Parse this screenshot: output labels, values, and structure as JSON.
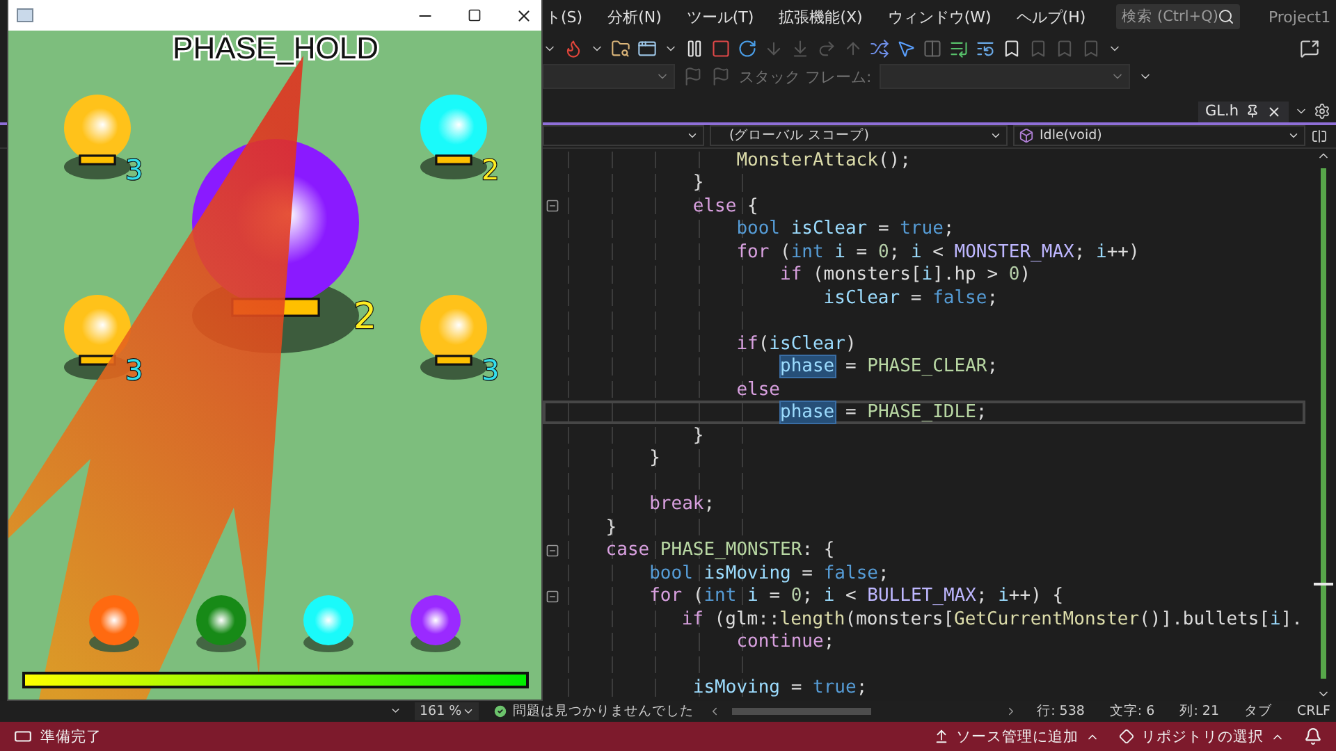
{
  "ide": {
    "menu": [
      "ト(S)",
      "分析(N)",
      "ツール(T)",
      "拡張機能(X)",
      "ウィンドウ(W)",
      "ヘルプ(H)"
    ],
    "search": {
      "placeholder": "検索 (Ctrl+Q)"
    },
    "project": "Project1",
    "debug_toolbar": {
      "stack_frame_label": "スタック フレーム:"
    },
    "document_tab": {
      "label": "GL.h",
      "selected": true
    },
    "nav_bar": {
      "scope": "(グローバル スコープ)",
      "member": "Idle(void)"
    },
    "code": {
      "lines": [
        {
          "fold": false,
          "current": false,
          "tokens": [
            {
              "kind": "fn",
              "text": "\t\t\t\tMonsterAttack"
            },
            {
              "kind": "plain",
              "text": "();"
            }
          ]
        },
        {
          "fold": false,
          "current": false,
          "tokens": [
            {
              "kind": "plain",
              "text": "\t\t\t}"
            }
          ]
        },
        {
          "fold": true,
          "current": false,
          "tokens": [
            {
              "kind": "ctrl",
              "text": "\t\t\telse"
            },
            {
              "kind": "plain",
              "text": " {"
            }
          ]
        },
        {
          "fold": false,
          "current": false,
          "tokens": [
            {
              "kind": "kw",
              "text": "\t\t\t\tbool"
            },
            {
              "kind": "var",
              "text": " isClear"
            },
            {
              "kind": "plain",
              "text": " = "
            },
            {
              "kind": "kw",
              "text": "true"
            },
            {
              "kind": "plain",
              "text": ";"
            }
          ]
        },
        {
          "fold": false,
          "current": false,
          "tokens": [
            {
              "kind": "ctrl",
              "text": "\t\t\t\tfor"
            },
            {
              "kind": "plain",
              "text": " ("
            },
            {
              "kind": "kw",
              "text": "int"
            },
            {
              "kind": "var",
              "text": " i"
            },
            {
              "kind": "plain",
              "text": " = "
            },
            {
              "kind": "num",
              "text": "0"
            },
            {
              "kind": "plain",
              "text": "; "
            },
            {
              "kind": "var",
              "text": "i"
            },
            {
              "kind": "plain",
              "text": " < "
            },
            {
              "kind": "macro",
              "text": "MONSTER_MAX"
            },
            {
              "kind": "plain",
              "text": "; "
            },
            {
              "kind": "var",
              "text": "i"
            },
            {
              "kind": "plain",
              "text": "++)"
            }
          ]
        },
        {
          "fold": false,
          "current": false,
          "tokens": [
            {
              "kind": "ctrl",
              "text": "\t\t\t\t\tif"
            },
            {
              "kind": "plain",
              "text": " (monsters["
            },
            {
              "kind": "var",
              "text": "i"
            },
            {
              "kind": "plain",
              "text": "].hp > "
            },
            {
              "kind": "num",
              "text": "0"
            },
            {
              "kind": "plain",
              "text": ")"
            }
          ]
        },
        {
          "fold": false,
          "current": false,
          "tokens": [
            {
              "kind": "var",
              "text": "\t\t\t\t\t\tisClear"
            },
            {
              "kind": "plain",
              "text": " = "
            },
            {
              "kind": "kw",
              "text": "false"
            },
            {
              "kind": "plain",
              "text": ";"
            }
          ]
        },
        {
          "fold": false,
          "current": false
        },
        {
          "fold": false,
          "current": false,
          "tokens": [
            {
              "kind": "ctrl",
              "text": "\t\t\t\tif"
            },
            {
              "kind": "plain",
              "text": "("
            },
            {
              "kind": "var",
              "text": "isClear"
            },
            {
              "kind": "plain",
              "text": ")"
            }
          ]
        },
        {
          "fold": false,
          "current": false,
          "tokens": [
            {
              "kind": "sel",
              "text": "\t\t\t\t\tphase"
            },
            {
              "kind": "plain",
              "text": " = "
            },
            {
              "kind": "enum",
              "text": "PHASE_CLEAR"
            },
            {
              "kind": "plain",
              "text": ";"
            }
          ]
        },
        {
          "fold": false,
          "current": false,
          "tokens": [
            {
              "kind": "ctrl",
              "text": "\t\t\t\telse"
            }
          ]
        },
        {
          "fold": false,
          "current": true,
          "tokens": [
            {
              "kind": "sel",
              "text": "\t\t\t\t\tphase"
            },
            {
              "kind": "plain",
              "text": " = "
            },
            {
              "kind": "enum",
              "text": "PHASE_IDLE"
            },
            {
              "kind": "plain",
              "text": ";"
            }
          ]
        },
        {
          "fold": false,
          "current": false,
          "tokens": [
            {
              "kind": "plain",
              "text": "\t\t\t}"
            }
          ]
        },
        {
          "fold": false,
          "current": false,
          "tokens": [
            {
              "kind": "plain",
              "text": "\t\t}"
            }
          ]
        },
        {
          "fold": false,
          "current": false
        },
        {
          "fold": false,
          "current": false,
          "tokens": [
            {
              "kind": "ctrl",
              "text": "\t\tbreak"
            },
            {
              "kind": "plain",
              "text": ";"
            }
          ]
        },
        {
          "fold": false,
          "current": false,
          "tokens": [
            {
              "kind": "plain",
              "text": "\t}"
            }
          ]
        },
        {
          "fold": true,
          "current": false,
          "tokens": [
            {
              "kind": "ctrl",
              "text": "\tcase"
            },
            {
              "kind": "enum",
              "text": " PHASE_MONSTER"
            },
            {
              "kind": "plain",
              "text": ": {"
            }
          ]
        },
        {
          "fold": false,
          "current": false,
          "tokens": [
            {
              "kind": "kw",
              "text": "\t\tbool"
            },
            {
              "kind": "var",
              "text": " isMoving"
            },
            {
              "kind": "plain",
              "text": " = "
            },
            {
              "kind": "kw",
              "text": "false"
            },
            {
              "kind": "plain",
              "text": ";"
            }
          ]
        },
        {
          "fold": true,
          "current": false,
          "tokens": [
            {
              "kind": "ctrl",
              "text": "\t\tfor"
            },
            {
              "kind": "plain",
              "text": " ("
            },
            {
              "kind": "kw",
              "text": "int"
            },
            {
              "kind": "var",
              "text": " i"
            },
            {
              "kind": "plain",
              "text": " = "
            },
            {
              "kind": "num",
              "text": "0"
            },
            {
              "kind": "plain",
              "text": "; "
            },
            {
              "kind": "var",
              "text": "i"
            },
            {
              "kind": "plain",
              "text": " < "
            },
            {
              "kind": "macro",
              "text": "BULLET_MAX"
            },
            {
              "kind": "plain",
              "text": "; "
            },
            {
              "kind": "var",
              "text": "i"
            },
            {
              "kind": "plain",
              "text": "++) {"
            }
          ]
        },
        {
          "fold": false,
          "current": false,
          "tokens": [
            {
              "kind": "ctrl",
              "text": "\t\t\tif"
            },
            {
              "kind": "plain",
              "text": " (glm::"
            },
            {
              "kind": "fn",
              "text": "length"
            },
            {
              "kind": "plain",
              "text": "(monsters["
            },
            {
              "kind": "fn",
              "text": "GetCurrentMonster"
            },
            {
              "kind": "plain",
              "text": "()].bullets["
            },
            {
              "kind": "var",
              "text": "i"
            },
            {
              "kind": "plain",
              "text": "]."
            }
          ]
        },
        {
          "fold": false,
          "current": false,
          "tokens": [
            {
              "kind": "ctrl",
              "text": "\t\t\t\tcontinue"
            },
            {
              "kind": "plain",
              "text": ";"
            }
          ]
        },
        {
          "fold": false,
          "current": false
        },
        {
          "fold": false,
          "current": false,
          "tokens": [
            {
              "kind": "var",
              "text": "\t\t\tisMoving"
            },
            {
              "kind": "plain",
              "text": " = "
            },
            {
              "kind": "kw",
              "text": "true"
            },
            {
              "kind": "plain",
              "text": ";"
            }
          ]
        }
      ]
    },
    "editor_status": {
      "zoom": "161 %",
      "issues": "問題は見つかりませんでした",
      "line": "行: 538",
      "char": "文字: 6",
      "col": "列: 21",
      "indent": "タブ",
      "eol": "CRLF"
    },
    "status_bar": {
      "message": "準備完了",
      "source_control": "ソース管理に追加",
      "repository": "リポジトリの選択"
    }
  },
  "game_window": {
    "phase_label": "PHASE_HOLD",
    "monsters": [
      {
        "kind": "small",
        "color": "#ffc21a",
        "level": 1,
        "count": {
          "text": "3",
          "color": "#33e0ee"
        }
      },
      {
        "kind": "small",
        "color": "#1afafa",
        "level": 1,
        "count": {
          "text": "2",
          "color": "#ffee22"
        }
      },
      {
        "kind": "boss",
        "color": "#8a1aff",
        "level": 1,
        "count": {
          "text": "2",
          "color": "#ffee22"
        }
      },
      {
        "kind": "small",
        "color": "#ffc21a",
        "level": 1,
        "count": {
          "text": "3",
          "color": "#33e0ee"
        }
      },
      {
        "kind": "small",
        "color": "#ffc21a",
        "level": 1,
        "count": {
          "text": "3",
          "color": "#33e0ee"
        }
      }
    ],
    "party": [
      {
        "color": "#ff6a10"
      },
      {
        "color": "#178a17"
      },
      {
        "color": "#1afafa"
      },
      {
        "color": "#9a2aff"
      }
    ],
    "player_hp": {
      "level": 1
    }
  }
}
